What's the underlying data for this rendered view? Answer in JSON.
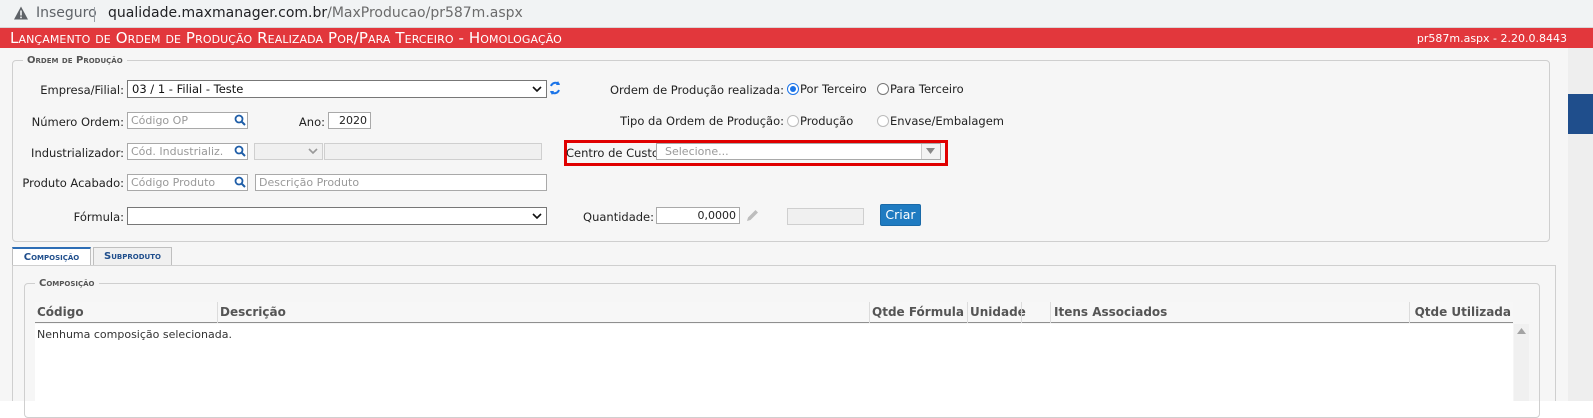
{
  "browser": {
    "security_label": "Inseguro",
    "url_host": "qualidade.maxmanager.com.br",
    "url_path": "/MaxProducao/pr587m.aspx"
  },
  "header": {
    "title": "Lançamento de Ordem de Produção Realizada Por/Para Terceiro  - Homologação",
    "version": "pr587m.aspx - 2.20.0.8443",
    "color": "#e2373c"
  },
  "form": {
    "legend": "Ordem de Produção",
    "empresa_label": "Empresa/Filial:",
    "empresa_value": "03 / 1 - Filial - Teste",
    "numero_label": "Número Ordem:",
    "numero_placeholder": "Código OP",
    "ano_label": "Ano:",
    "ano_value": "2020",
    "industrializador_label": "Industrializador:",
    "industrializador_placeholder": "Cód. Industrializ.",
    "produto_label": "Produto Acabado:",
    "produto_placeholder": "Código Produto",
    "produto_desc_placeholder": "Descrição Produto",
    "formula_label": "Fórmula:",
    "op_realizada_label": "Ordem de Produção realizada:",
    "op_realizada_options": [
      "Por Terceiro",
      "Para Terceiro"
    ],
    "op_realizada_selected": "Por Terceiro",
    "tipo_label": "Tipo da Ordem de Produção:",
    "tipo_options": [
      "Produção",
      "Envase/Embalagem"
    ],
    "centro_label": "Centro de Custo:",
    "centro_placeholder": "Selecione...",
    "quantidade_label": "Quantidade:",
    "quantidade_value": "0,0000",
    "criar_label": "Criar",
    "accent": "#1f7bc1"
  },
  "tabs": [
    {
      "label": "Composição",
      "active": true
    },
    {
      "label": "Subproduto",
      "active": false
    }
  ],
  "composicao": {
    "legend": "Composição",
    "columns": [
      "Código",
      "Descrição",
      "Qtde Fórmula",
      "Unidade",
      "",
      "Itens Associados",
      "Qtde Utilizada"
    ],
    "empty_text": "Nenhuma composição selecionada."
  }
}
